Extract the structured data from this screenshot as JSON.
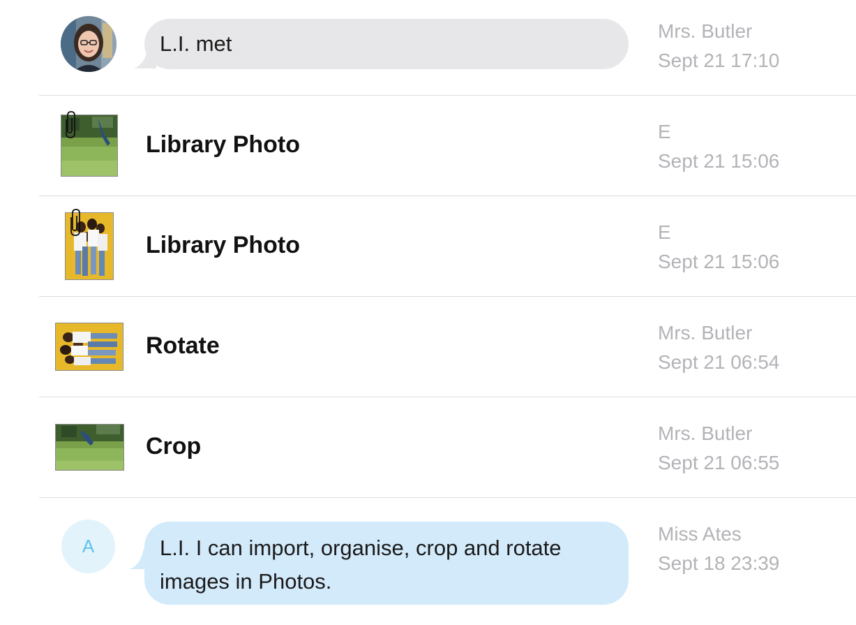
{
  "messages": [
    {
      "kind": "chat",
      "avatar": "teacher-photo",
      "text": "L.I. met",
      "author": "Mrs. Butler",
      "time": "Sept 21 17:10"
    },
    {
      "kind": "post",
      "thumbnail": "grass-photo-icon",
      "attachment": true,
      "title": "Library Photo",
      "author": "E",
      "time": "Sept 21 15:06"
    },
    {
      "kind": "post",
      "thumbnail": "group-portrait-icon",
      "attachment": true,
      "title": "Library Photo",
      "author": "E",
      "time": "Sept 21 15:06"
    },
    {
      "kind": "post",
      "thumbnail": "rotated-group-icon",
      "attachment": false,
      "title": "Rotate",
      "author": "Mrs. Butler",
      "time": "Sept 21 06:54"
    },
    {
      "kind": "post",
      "thumbnail": "cropped-grass-icon",
      "attachment": false,
      "title": "Crop",
      "author": "Mrs. Butler",
      "time": "Sept 21 06:55"
    },
    {
      "kind": "chat",
      "avatar_letter": "A",
      "text_line1": "L.I. I can import, organise, crop and rotate",
      "text_line2": "images in Photos.",
      "author": "Miss Ates",
      "time": "Sept 18 23:39"
    }
  ],
  "colors": {
    "grey_bubble": "#e7e7e9",
    "blue_bubble": "#d3eafb",
    "meta_text": "#b3b3b8",
    "avatar_letter": "#5ec1ea"
  }
}
